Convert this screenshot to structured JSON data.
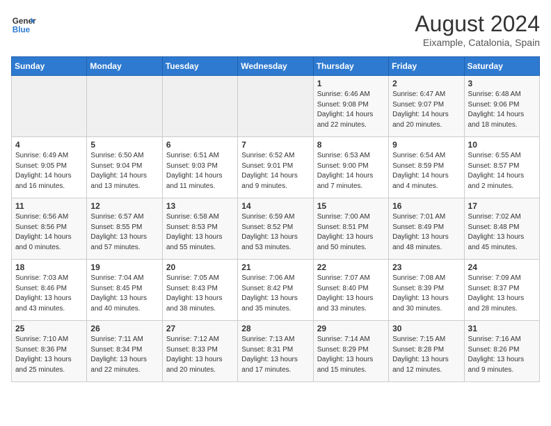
{
  "header": {
    "logo_line1": "General",
    "logo_line2": "Blue",
    "month_title": "August 2024",
    "subtitle": "Eixample, Catalonia, Spain"
  },
  "weekdays": [
    "Sunday",
    "Monday",
    "Tuesday",
    "Wednesday",
    "Thursday",
    "Friday",
    "Saturday"
  ],
  "weeks": [
    [
      {
        "day": "",
        "info": ""
      },
      {
        "day": "",
        "info": ""
      },
      {
        "day": "",
        "info": ""
      },
      {
        "day": "",
        "info": ""
      },
      {
        "day": "1",
        "info": "Sunrise: 6:46 AM\nSunset: 9:08 PM\nDaylight: 14 hours\nand 22 minutes."
      },
      {
        "day": "2",
        "info": "Sunrise: 6:47 AM\nSunset: 9:07 PM\nDaylight: 14 hours\nand 20 minutes."
      },
      {
        "day": "3",
        "info": "Sunrise: 6:48 AM\nSunset: 9:06 PM\nDaylight: 14 hours\nand 18 minutes."
      }
    ],
    [
      {
        "day": "4",
        "info": "Sunrise: 6:49 AM\nSunset: 9:05 PM\nDaylight: 14 hours\nand 16 minutes."
      },
      {
        "day": "5",
        "info": "Sunrise: 6:50 AM\nSunset: 9:04 PM\nDaylight: 14 hours\nand 13 minutes."
      },
      {
        "day": "6",
        "info": "Sunrise: 6:51 AM\nSunset: 9:03 PM\nDaylight: 14 hours\nand 11 minutes."
      },
      {
        "day": "7",
        "info": "Sunrise: 6:52 AM\nSunset: 9:01 PM\nDaylight: 14 hours\nand 9 minutes."
      },
      {
        "day": "8",
        "info": "Sunrise: 6:53 AM\nSunset: 9:00 PM\nDaylight: 14 hours\nand 7 minutes."
      },
      {
        "day": "9",
        "info": "Sunrise: 6:54 AM\nSunset: 8:59 PM\nDaylight: 14 hours\nand 4 minutes."
      },
      {
        "day": "10",
        "info": "Sunrise: 6:55 AM\nSunset: 8:57 PM\nDaylight: 14 hours\nand 2 minutes."
      }
    ],
    [
      {
        "day": "11",
        "info": "Sunrise: 6:56 AM\nSunset: 8:56 PM\nDaylight: 14 hours\nand 0 minutes."
      },
      {
        "day": "12",
        "info": "Sunrise: 6:57 AM\nSunset: 8:55 PM\nDaylight: 13 hours\nand 57 minutes."
      },
      {
        "day": "13",
        "info": "Sunrise: 6:58 AM\nSunset: 8:53 PM\nDaylight: 13 hours\nand 55 minutes."
      },
      {
        "day": "14",
        "info": "Sunrise: 6:59 AM\nSunset: 8:52 PM\nDaylight: 13 hours\nand 53 minutes."
      },
      {
        "day": "15",
        "info": "Sunrise: 7:00 AM\nSunset: 8:51 PM\nDaylight: 13 hours\nand 50 minutes."
      },
      {
        "day": "16",
        "info": "Sunrise: 7:01 AM\nSunset: 8:49 PM\nDaylight: 13 hours\nand 48 minutes."
      },
      {
        "day": "17",
        "info": "Sunrise: 7:02 AM\nSunset: 8:48 PM\nDaylight: 13 hours\nand 45 minutes."
      }
    ],
    [
      {
        "day": "18",
        "info": "Sunrise: 7:03 AM\nSunset: 8:46 PM\nDaylight: 13 hours\nand 43 minutes."
      },
      {
        "day": "19",
        "info": "Sunrise: 7:04 AM\nSunset: 8:45 PM\nDaylight: 13 hours\nand 40 minutes."
      },
      {
        "day": "20",
        "info": "Sunrise: 7:05 AM\nSunset: 8:43 PM\nDaylight: 13 hours\nand 38 minutes."
      },
      {
        "day": "21",
        "info": "Sunrise: 7:06 AM\nSunset: 8:42 PM\nDaylight: 13 hours\nand 35 minutes."
      },
      {
        "day": "22",
        "info": "Sunrise: 7:07 AM\nSunset: 8:40 PM\nDaylight: 13 hours\nand 33 minutes."
      },
      {
        "day": "23",
        "info": "Sunrise: 7:08 AM\nSunset: 8:39 PM\nDaylight: 13 hours\nand 30 minutes."
      },
      {
        "day": "24",
        "info": "Sunrise: 7:09 AM\nSunset: 8:37 PM\nDaylight: 13 hours\nand 28 minutes."
      }
    ],
    [
      {
        "day": "25",
        "info": "Sunrise: 7:10 AM\nSunset: 8:36 PM\nDaylight: 13 hours\nand 25 minutes."
      },
      {
        "day": "26",
        "info": "Sunrise: 7:11 AM\nSunset: 8:34 PM\nDaylight: 13 hours\nand 22 minutes."
      },
      {
        "day": "27",
        "info": "Sunrise: 7:12 AM\nSunset: 8:33 PM\nDaylight: 13 hours\nand 20 minutes."
      },
      {
        "day": "28",
        "info": "Sunrise: 7:13 AM\nSunset: 8:31 PM\nDaylight: 13 hours\nand 17 minutes."
      },
      {
        "day": "29",
        "info": "Sunrise: 7:14 AM\nSunset: 8:29 PM\nDaylight: 13 hours\nand 15 minutes."
      },
      {
        "day": "30",
        "info": "Sunrise: 7:15 AM\nSunset: 8:28 PM\nDaylight: 13 hours\nand 12 minutes."
      },
      {
        "day": "31",
        "info": "Sunrise: 7:16 AM\nSunset: 8:26 PM\nDaylight: 13 hours\nand 9 minutes."
      }
    ]
  ]
}
